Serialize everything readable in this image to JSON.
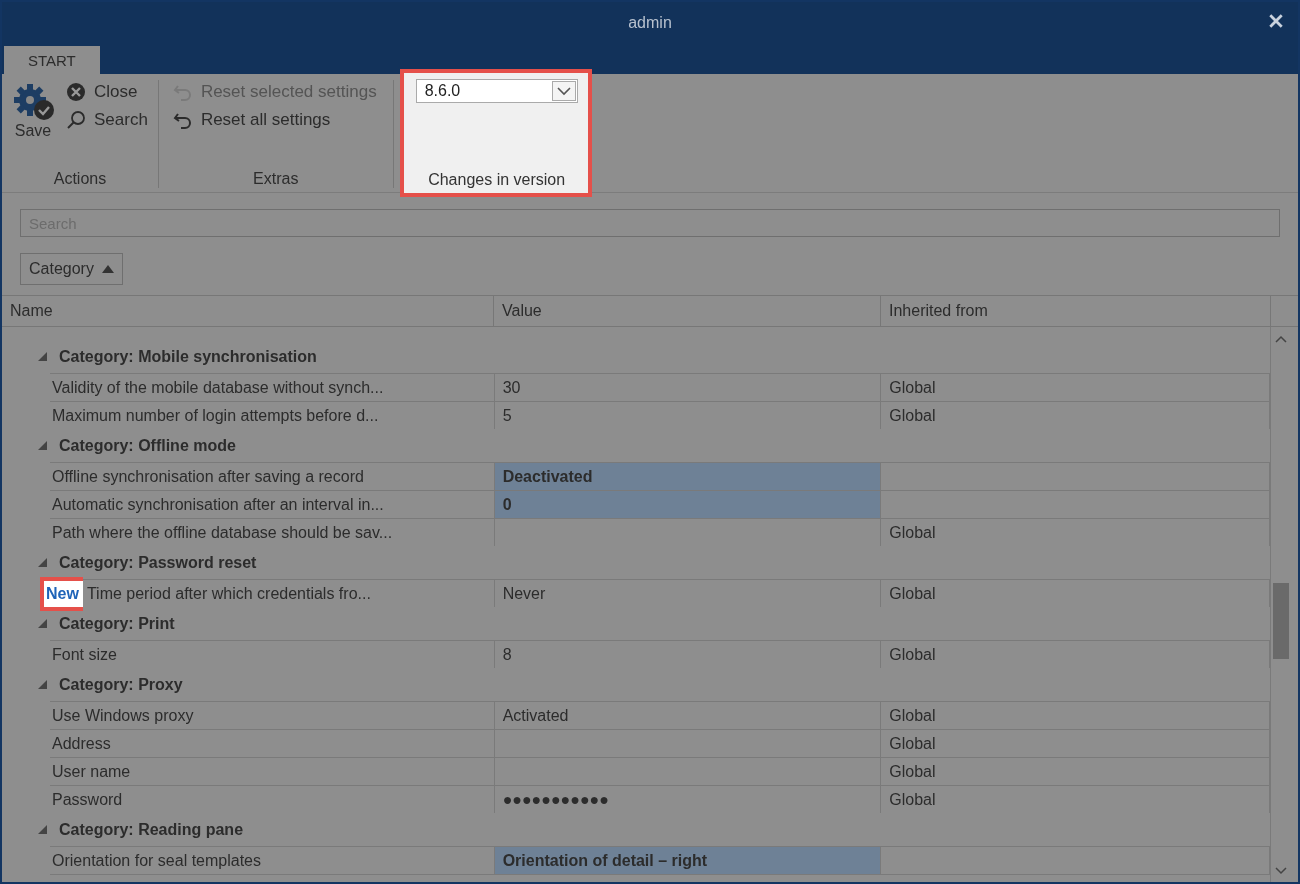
{
  "window": {
    "title": "admin"
  },
  "tabs": [
    {
      "label": "START",
      "selected": true
    }
  ],
  "ribbon": {
    "groups": [
      {
        "label": "Actions",
        "buttons": [
          {
            "kind": "save",
            "label": "Save"
          },
          {
            "kind": "close",
            "label": "Close"
          },
          {
            "kind": "search",
            "label": "Search"
          }
        ]
      },
      {
        "label": "Extras",
        "buttons": [
          {
            "kind": "reset",
            "label": "Reset selected settings",
            "disabled": true
          },
          {
            "kind": "reset",
            "label": "Reset all settings",
            "disabled": false
          }
        ]
      }
    ],
    "version": {
      "value": "8.6.0",
      "label": "Changes in version"
    }
  },
  "search": {
    "placeholder": "Search"
  },
  "sort": {
    "label": "Category"
  },
  "table": {
    "columns": [
      "Name",
      "Value",
      "Inherited from"
    ],
    "categories": [
      {
        "title": "Category: Mobile synchronisation",
        "expanded": true,
        "rows": [
          {
            "name": "Validity of the mobile database without synch...",
            "value": "30",
            "inherited": "Global",
            "selected": false
          },
          {
            "name": "Maximum number of login attempts before d...",
            "value": "5",
            "inherited": "Global",
            "selected": false
          }
        ]
      },
      {
        "title": "Category: Offline mode",
        "expanded": true,
        "rows": [
          {
            "name": "Offline synchronisation after saving a record",
            "value": "Deactivated",
            "inherited": "",
            "selected": true
          },
          {
            "name": "Automatic synchronisation after an interval in...",
            "value": "0",
            "inherited": "",
            "selected": true
          },
          {
            "name": "Path where the offline database should be sav...",
            "value": "",
            "inherited": "Global",
            "selected": false
          }
        ]
      },
      {
        "title": "Category: Password reset",
        "expanded": true,
        "rows": [
          {
            "badge": "New",
            "name": "Time period after which credentials fro...",
            "value": "Never",
            "inherited": "Global",
            "selected": false
          }
        ]
      },
      {
        "title": "Category: Print",
        "expanded": true,
        "rows": [
          {
            "name": "Font size",
            "value": "8",
            "inherited": "Global",
            "selected": false
          }
        ]
      },
      {
        "title": "Category: Proxy",
        "expanded": true,
        "rows": [
          {
            "name": "Use Windows proxy",
            "value": "Activated",
            "inherited": "Global",
            "selected": false
          },
          {
            "name": "Address",
            "value": "",
            "inherited": "Global",
            "selected": false
          },
          {
            "name": "User name",
            "value": "",
            "inherited": "Global",
            "selected": false
          },
          {
            "name": "Password",
            "value": "●●●●●●●●●●●",
            "inherited": "Global",
            "selected": false
          }
        ]
      },
      {
        "title": "Category: Reading pane",
        "expanded": true,
        "rows": [
          {
            "name": "Orientation for seal templates",
            "value": "Orientation of detail – right",
            "inherited": "",
            "selected": true
          }
        ]
      }
    ]
  }
}
